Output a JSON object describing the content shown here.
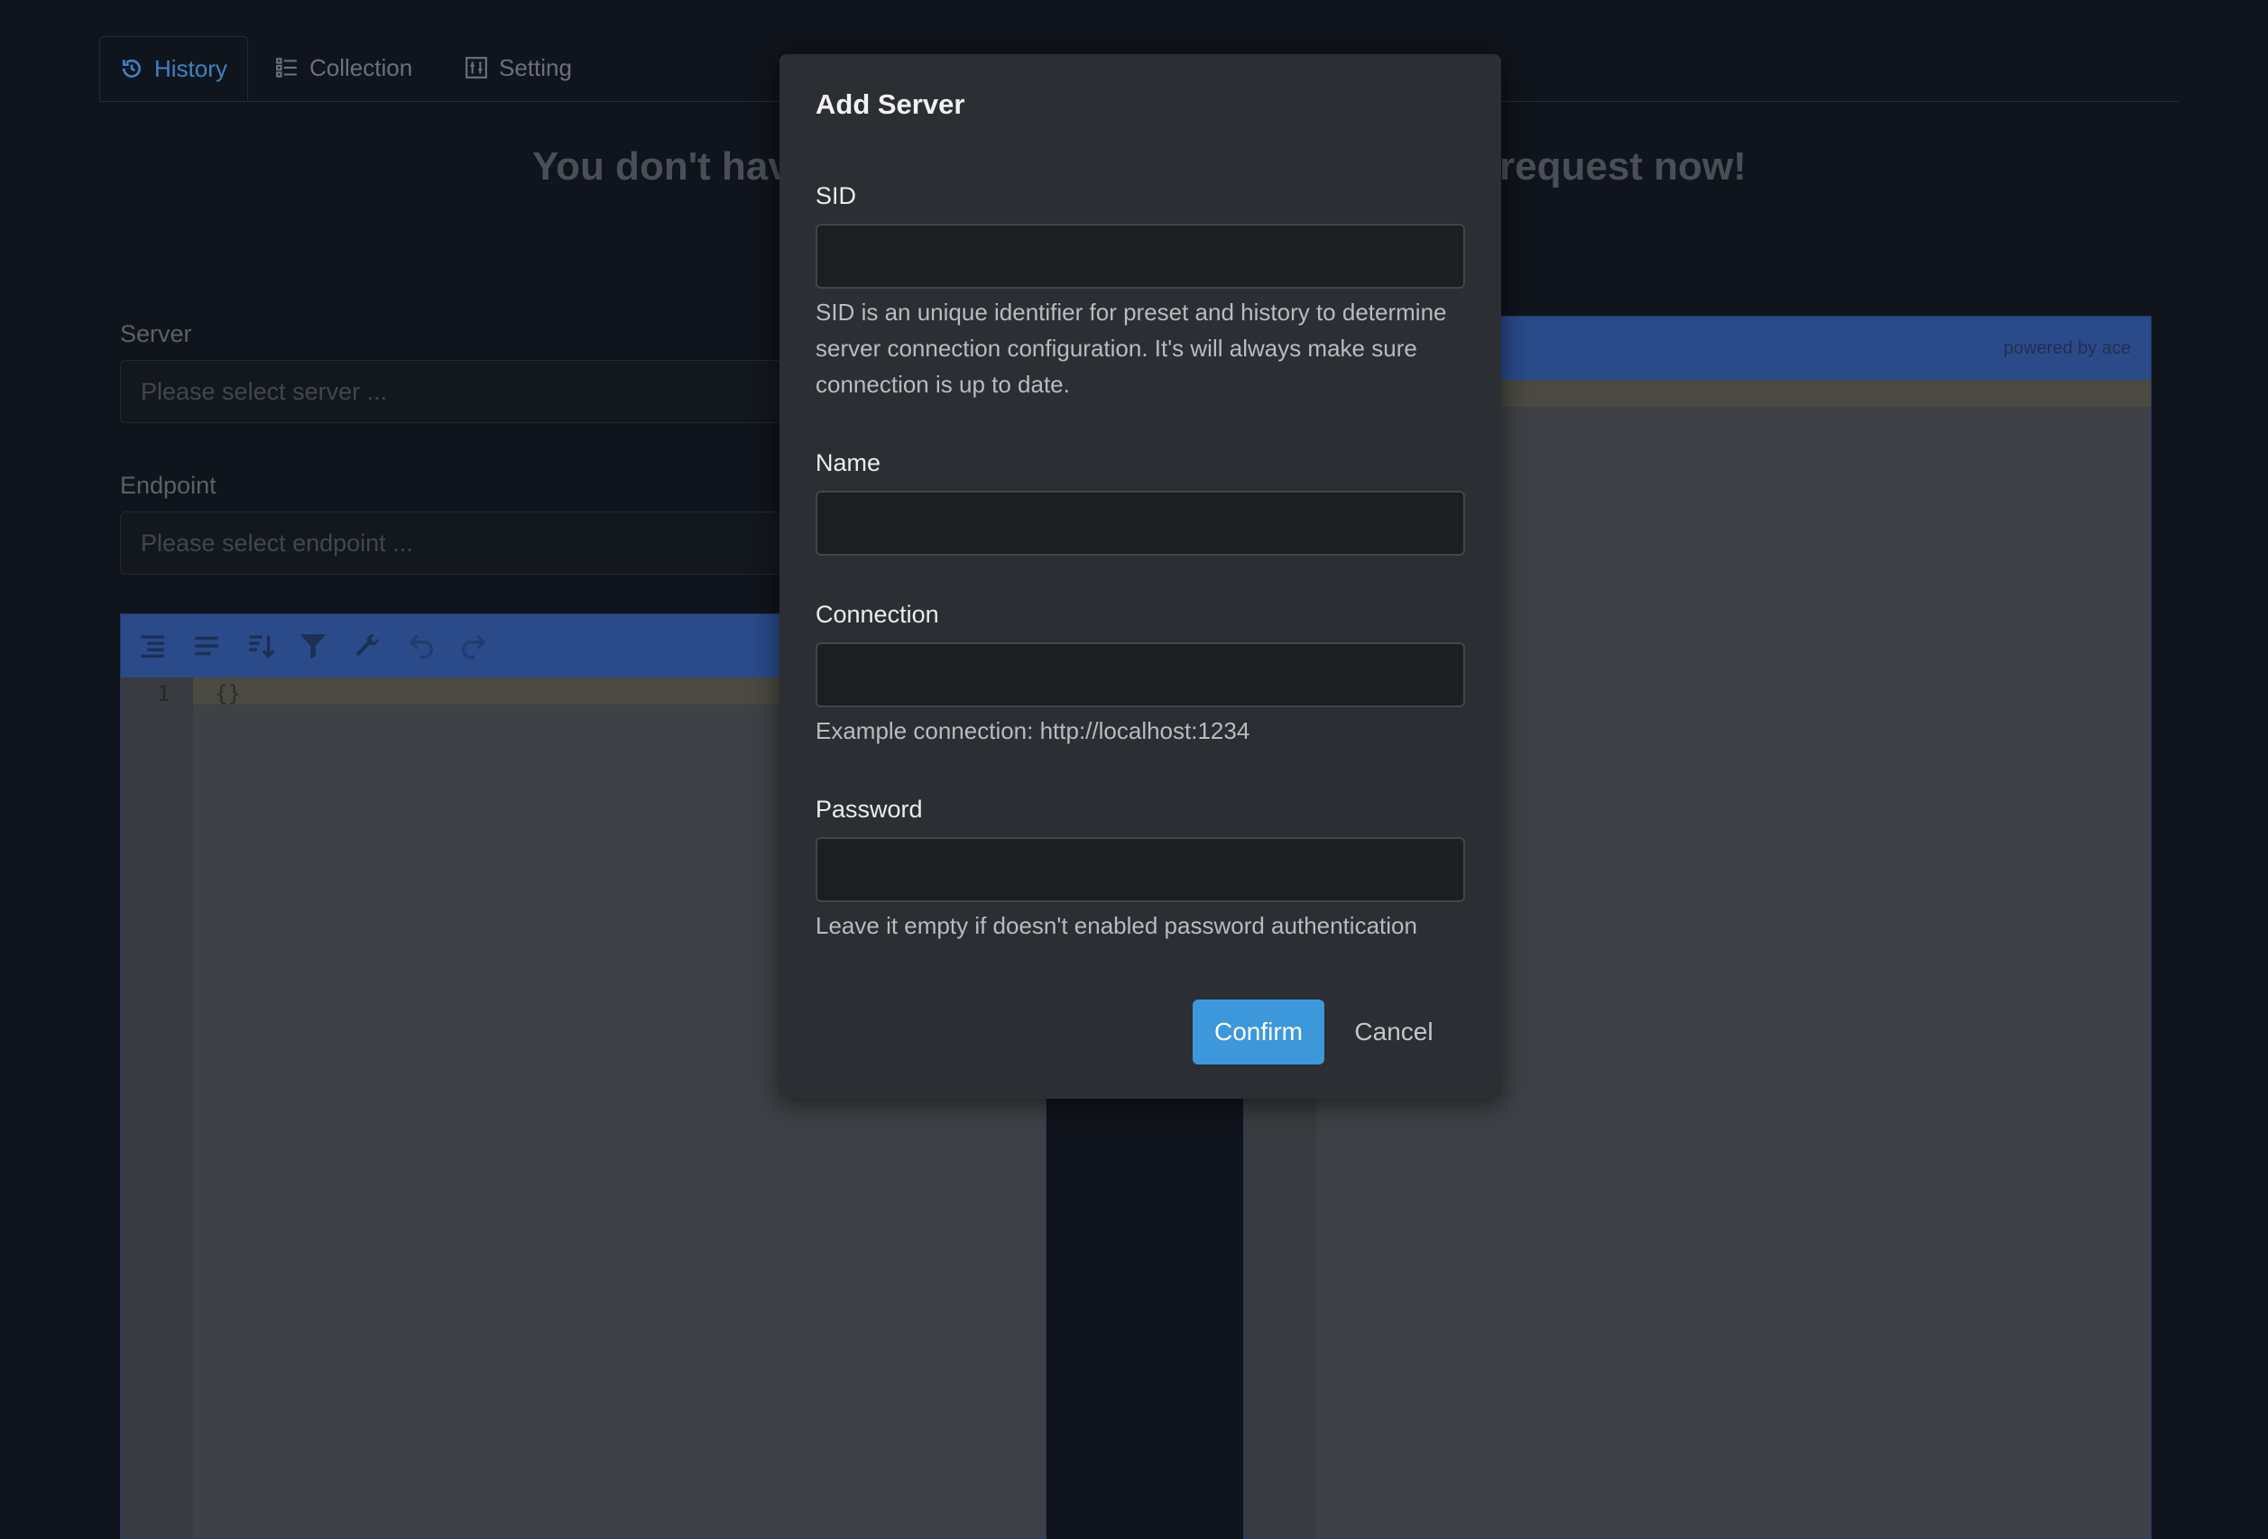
{
  "tabs": [
    {
      "label": "History",
      "icon": "history-icon",
      "active": true
    },
    {
      "label": "Collection",
      "icon": "list-icon",
      "active": false
    },
    {
      "label": "Setting",
      "icon": "sliders-icon",
      "active": false
    }
  ],
  "empty_state": {
    "text_left": "You don't hav",
    "text_right": "request now!"
  },
  "server": {
    "label": "Server",
    "placeholder": "Please select server ..."
  },
  "endpoint": {
    "label": "Endpoint",
    "placeholder": "Please select endpoint ..."
  },
  "request_editor": {
    "line_number": "1",
    "code": "{}",
    "toolbar_icons": [
      "format-icon",
      "compact-icon",
      "sort-icon",
      "filter-icon",
      "repair-icon",
      "undo-icon",
      "redo-icon"
    ]
  },
  "response_editor": {
    "powered_by": "powered by ace"
  },
  "modal": {
    "title": "Add Server",
    "sid": {
      "label": "SID",
      "value": "",
      "help": "SID is an unique identifier for preset and history to determine server connection configuration. It's will always make sure connection is up to date."
    },
    "name": {
      "label": "Name",
      "value": ""
    },
    "connection": {
      "label": "Connection",
      "value": "",
      "help": "Example connection: http://localhost:1234"
    },
    "password": {
      "label": "Password",
      "value": "",
      "help": "Leave it empty if doesn't enabled password authentication"
    },
    "confirm_label": "Confirm",
    "cancel_label": "Cancel"
  },
  "colors": {
    "accent": "#3d97db",
    "modal_bg": "#2b2e33",
    "page_bg": "#10141c"
  }
}
